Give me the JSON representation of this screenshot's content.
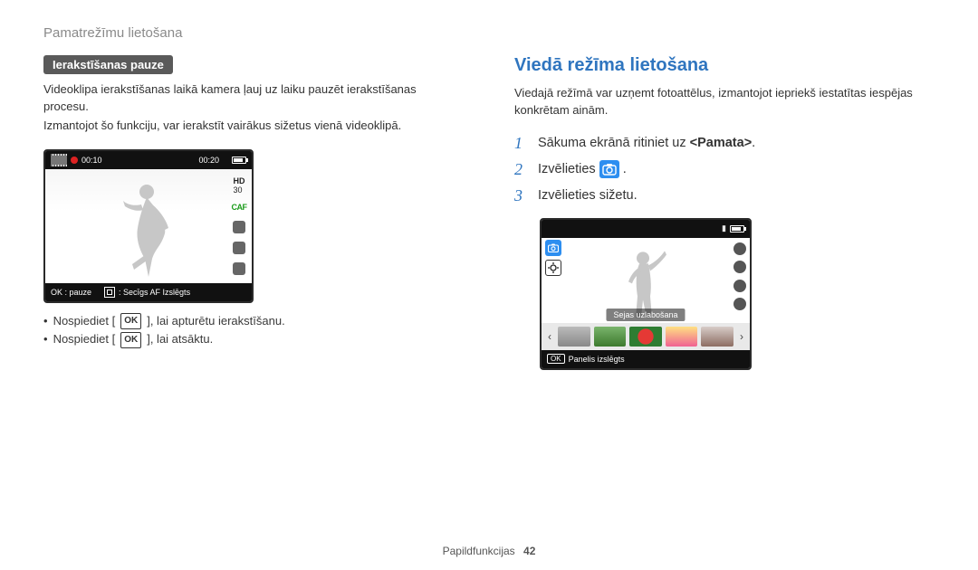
{
  "page": {
    "section": "Pamatrežīmu lietošana",
    "footer_label": "Papildfunkcijas",
    "footer_page": "42"
  },
  "left": {
    "tag": "Ierakstīšanas pauze",
    "para1": "Videoklipa ierakstīšanas laikā kamera ļauj uz laiku pauzēt ierakstīšanas procesu.",
    "para2": "Izmantojot šo funkciju, var ierakstīt vairākus sižetus vienā videoklipā.",
    "lcd": {
      "time_left": "00:10",
      "time_right": "00:20",
      "hd_label": "HD",
      "fps_label": "30",
      "caf_label": "CAF",
      "bottom_ok": "OK : pauze",
      "bottom_af": ": Secīgs AF Izslēgts"
    },
    "bullets": {
      "b1a": "Nospiediet [",
      "b1b": "], lai apturētu ierakstīšanu.",
      "b2a": "Nospiediet [",
      "b2b": "], lai atsāktu."
    }
  },
  "right": {
    "heading": "Viedā režīma lietošana",
    "para1": "Viedajā režīmā var uzņemt fotoattēlus, izmantojot iepriekš iestatītas iespējas konkrētam ainām.",
    "steps": {
      "s1a": "Sākuma ekrānā ritiniet uz ",
      "s1b": "<Pamata>",
      "s1c": ".",
      "s2a": "Izvēlieties ",
      "s2b": ".",
      "s3": "Izvēlieties sižetu."
    },
    "lcd": {
      "scene_label": "Sejas uzlabošana",
      "bottom_ok": "OK",
      "bottom_text": "Panelis izslēgts"
    }
  }
}
